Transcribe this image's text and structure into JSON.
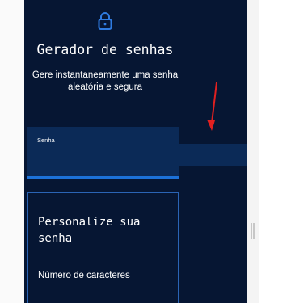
{
  "header": {
    "icon": "lock-icon",
    "title": "Gerador de senhas",
    "subtitle": "Gere instantaneamente uma senha aleatória e segura"
  },
  "password_field": {
    "label": "Senha",
    "value": ""
  },
  "customize": {
    "title": "Personalize sua senha",
    "length_label": "Número de caracteres"
  },
  "colors": {
    "app_background": "#061633",
    "field_background": "#0b2a57",
    "accent": "#1c71d8",
    "annotation_arrow": "#e02020"
  }
}
